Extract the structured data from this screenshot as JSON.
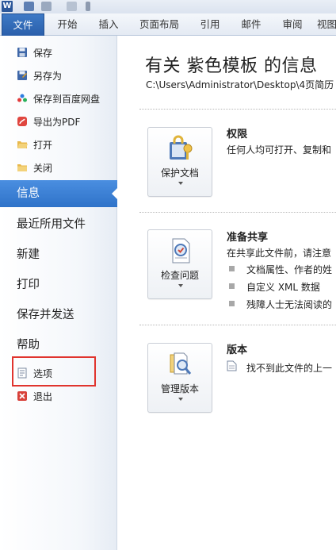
{
  "ribbon": {
    "tabs": [
      "文件",
      "开始",
      "插入",
      "页面布局",
      "引用",
      "邮件",
      "审阅",
      "视图"
    ]
  },
  "backstage": {
    "commands_top": [
      {
        "label": "保存",
        "icon": "save-icon"
      },
      {
        "label": "另存为",
        "icon": "save-as-icon"
      },
      {
        "label": "保存到百度网盘",
        "icon": "baidu-cloud-icon"
      },
      {
        "label": "导出为PDF",
        "icon": "pdf-icon"
      },
      {
        "label": "打开",
        "icon": "open-folder-icon"
      },
      {
        "label": "关闭",
        "icon": "close-folder-icon"
      }
    ],
    "tabs": [
      "信息",
      "最近所用文件",
      "新建",
      "打印",
      "保存并发送",
      "帮助"
    ],
    "active_tab": "信息",
    "commands_bottom": [
      {
        "label": "选项",
        "icon": "options-icon"
      },
      {
        "label": "退出",
        "icon": "exit-icon"
      }
    ]
  },
  "info": {
    "title": "有关 紫色模板 的信息",
    "path": "C:\\Users\\Administrator\\Desktop\\4页简历",
    "sections": [
      {
        "button_label": "保护文档",
        "button_icon": "lock-key-icon",
        "heading": "权限",
        "text": "任何人均可打开、复制和"
      },
      {
        "button_label": "检查问题",
        "button_icon": "inspect-document-icon",
        "heading": "准备共享",
        "text": "在共享此文件前，请注意",
        "bullets": [
          "文档属性、作者的姓",
          "自定义 XML 数据",
          "残障人士无法阅读的"
        ]
      },
      {
        "button_label": "管理版本",
        "button_icon": "manage-versions-icon",
        "heading": "版本",
        "text": "找不到此文件的上一"
      }
    ]
  },
  "colors": {
    "file_tab": "#2a5fab",
    "active_nav": "#3a80d5",
    "highlight_box": "#e0342e"
  }
}
